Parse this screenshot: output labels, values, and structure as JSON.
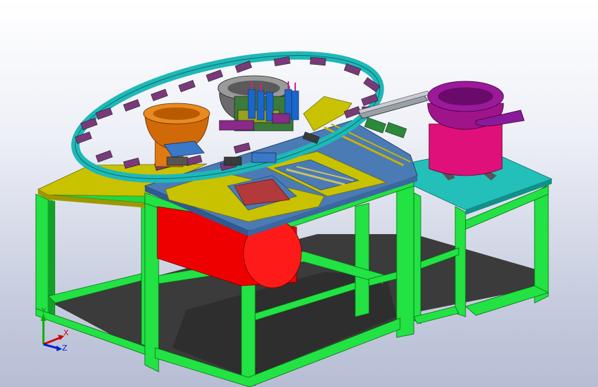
{
  "viewport": {
    "background": "gradient-light-gray",
    "model": "automated-assembly-machine"
  },
  "colors": {
    "frame": "#1fe040",
    "frame_dark": "#0b7a1a",
    "floor_shadow": "#3a3a3a",
    "tabletop_yellow": "#c9c200",
    "plate_blue": "#4a7bb5",
    "plate_cyan": "#1fb8b0",
    "red_bin": "#ee0000",
    "orange_bowl": "#e07a10",
    "gray_bowl": "#8a8a8a",
    "magenta_bowl": "#e0107a",
    "purple_rim": "#8a1a9a",
    "turntable_ring": "#20b8b8"
  },
  "axis_triad": {
    "y_label": "Y",
    "x_label": "X",
    "z_label": "Z"
  }
}
